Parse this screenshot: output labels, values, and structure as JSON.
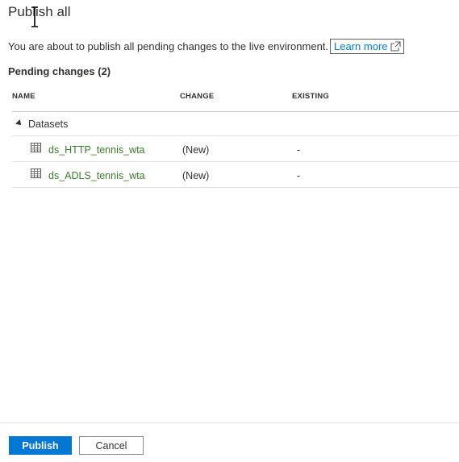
{
  "dialog": {
    "title": "Publish all",
    "description": "You are about to publish all pending changes to the live environment.",
    "learn_more": "Learn more"
  },
  "pending": {
    "heading": "Pending changes (2)",
    "columns": {
      "name": "NAME",
      "change": "CHANGE",
      "existing": "EXISTING"
    },
    "groups": [
      {
        "label": "Datasets",
        "items": [
          {
            "name": "ds_HTTP_tennis_wta",
            "change": "(New)",
            "existing": "-",
            "icon": "table-icon"
          },
          {
            "name": "ds_ADLS_tennis_wta",
            "change": "(New)",
            "existing": "-",
            "icon": "table-icon"
          }
        ]
      }
    ]
  },
  "footer": {
    "publish_label": "Publish",
    "cancel_label": "Cancel"
  },
  "colors": {
    "accent": "#0078d4",
    "link_green": "#3a7d2c",
    "text": "#323130"
  }
}
